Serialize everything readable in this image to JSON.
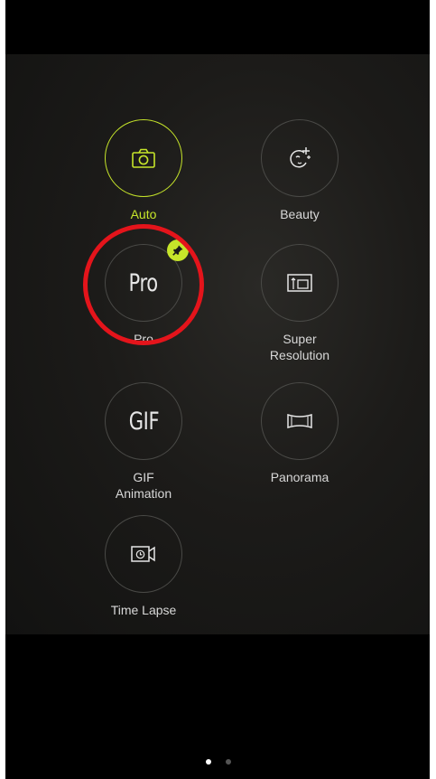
{
  "modes": [
    {
      "label": "Auto",
      "icon": "camera-icon",
      "active": true
    },
    {
      "label": "Beauty",
      "icon": "beauty-sparkle-icon",
      "active": false
    },
    {
      "label": "Pro",
      "circle_text": "Pro",
      "pinned": true,
      "icon": "pin-icon"
    },
    {
      "label": "Super\nResolution",
      "icon": "super-resolution-icon"
    },
    {
      "label": "GIF\nAnimation",
      "circle_text": "GIF"
    },
    {
      "label": "Panorama",
      "icon": "panorama-icon"
    },
    {
      "label": "Time Lapse",
      "icon": "time-lapse-icon"
    }
  ],
  "pagination": {
    "current": 1,
    "total": 2
  },
  "colors": {
    "accent": "#c6e52a",
    "highlight": "#e4141b",
    "text": "#d8d8d8",
    "dot_inactive": "#555555",
    "dot_active": "#ffffff"
  }
}
